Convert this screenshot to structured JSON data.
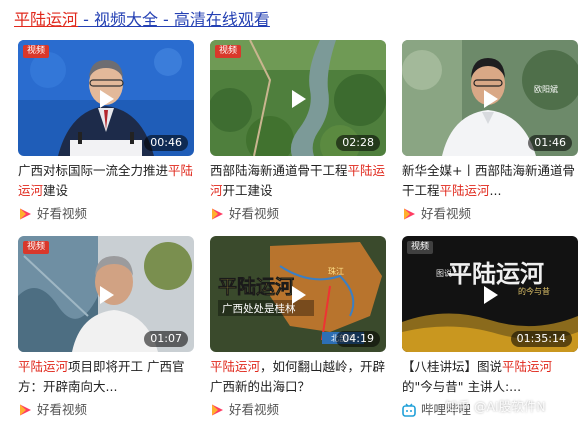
{
  "header": {
    "keyword": "平陆运河",
    "rest": " - 视频大全 - 高清在线观看"
  },
  "cards": [
    {
      "badge": "视频",
      "duration": "00:46",
      "title_parts": [
        "广西对标国际一流全力推进",
        "平陆运河",
        "建设"
      ],
      "source": "好看视频",
      "source_icon": "haokan-play-icon"
    },
    {
      "badge": "视频",
      "duration": "02:28",
      "title_parts": [
        "西部陆海新通道骨干工程",
        "平陆运河",
        "开工建设"
      ],
      "source": "好看视频",
      "source_icon": "haokan-play-icon"
    },
    {
      "badge": "",
      "duration": "01:46",
      "overlay_text": "欧阳斌",
      "title_parts": [
        "新华全媒+丨西部陆海新通道骨干工程",
        "平陆运河",
        "..."
      ],
      "source": "好看视频",
      "source_icon": "haokan-play-icon"
    },
    {
      "badge": "视频",
      "duration": "01:07",
      "title_parts": [
        "",
        "平陆运河",
        "项目即将开工 广西官方：开辟南向大..."
      ],
      "source": "好看视频",
      "source_icon": "haokan-play-icon"
    },
    {
      "badge": "",
      "duration": "04:19",
      "overlay_text": "平陆运河",
      "overlay_sub": "广西处处是桂林",
      "map_labels": [
        "珠江",
        "北部湾"
      ],
      "title_parts": [
        "",
        "平陆运河",
        "，如何翻山越岭，开辟广西新的出海口？"
      ],
      "source": "好看视频",
      "source_icon": "haokan-play-icon"
    },
    {
      "badge": "视频",
      "duration": "01:35:14",
      "overlay_text": "平陆运河",
      "overlay_prefix": "图说",
      "overlay_suffix": "的今与昔",
      "title_parts": [
        "【八桂讲坛】图说",
        "平陆运河",
        "的\"今与昔\" 主讲人:..."
      ],
      "source": "哔哩哔哩",
      "source_icon": "bilibili-tv-icon"
    }
  ],
  "watermark": "知乎 @AI股软件N",
  "colors": {
    "keyword": "#e0291d",
    "link": "#2440b3",
    "haokan": "#ff3d63",
    "bilibili": "#20a0d8"
  }
}
